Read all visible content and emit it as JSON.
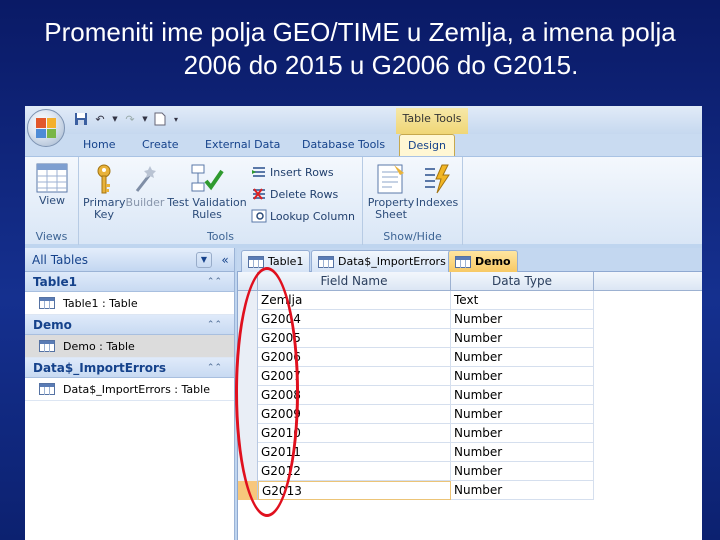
{
  "caption": {
    "line1": "Promeniti ime polja GEO/TIME u Zemlja, a imena polja",
    "line2": "2006 do 2015 u G2006 do G2015."
  },
  "context_tab": "Table Tools",
  "ribbon_tabs": [
    {
      "label": "Home"
    },
    {
      "label": "Create"
    },
    {
      "label": "External Data"
    },
    {
      "label": "Database Tools"
    },
    {
      "label": "Design"
    }
  ],
  "groups": {
    "views": {
      "label": "Views",
      "view": "View"
    },
    "tools": {
      "label": "Tools",
      "primary_key": "Primary Key",
      "builder": "Builder",
      "test_validation": "Test Validation Rules",
      "insert_rows": "Insert Rows",
      "delete_rows": "Delete Rows",
      "lookup_column": "Lookup Column"
    },
    "show_hide": {
      "label": "Show/Hide",
      "property_sheet": "Property Sheet",
      "indexes": "Indexes"
    }
  },
  "nav": {
    "header": "All Tables",
    "groups": [
      {
        "name": "Table1",
        "items": [
          "Table1 : Table"
        ]
      },
      {
        "name": "Demo",
        "items": [
          "Demo : Table"
        ]
      },
      {
        "name": "Data$_ImportErrors",
        "items": [
          "Data$_ImportErrors : Table"
        ]
      }
    ]
  },
  "doc_tabs": [
    "Table1",
    "Data$_ImportErrors",
    "Demo"
  ],
  "grid": {
    "columns": [
      "Field Name",
      "Data Type"
    ],
    "rows": [
      [
        "Zemlja",
        "Text"
      ],
      [
        "G2004",
        "Number"
      ],
      [
        "G2005",
        "Number"
      ],
      [
        "G2006",
        "Number"
      ],
      [
        "G2007",
        "Number"
      ],
      [
        "G2008",
        "Number"
      ],
      [
        "G2009",
        "Number"
      ],
      [
        "G2010",
        "Number"
      ],
      [
        "G2011",
        "Number"
      ],
      [
        "G2012",
        "Number"
      ],
      [
        "G2013",
        "Number"
      ]
    ]
  },
  "colors": {
    "annotation": "#e0101e",
    "active_tab": "#f7c965"
  }
}
